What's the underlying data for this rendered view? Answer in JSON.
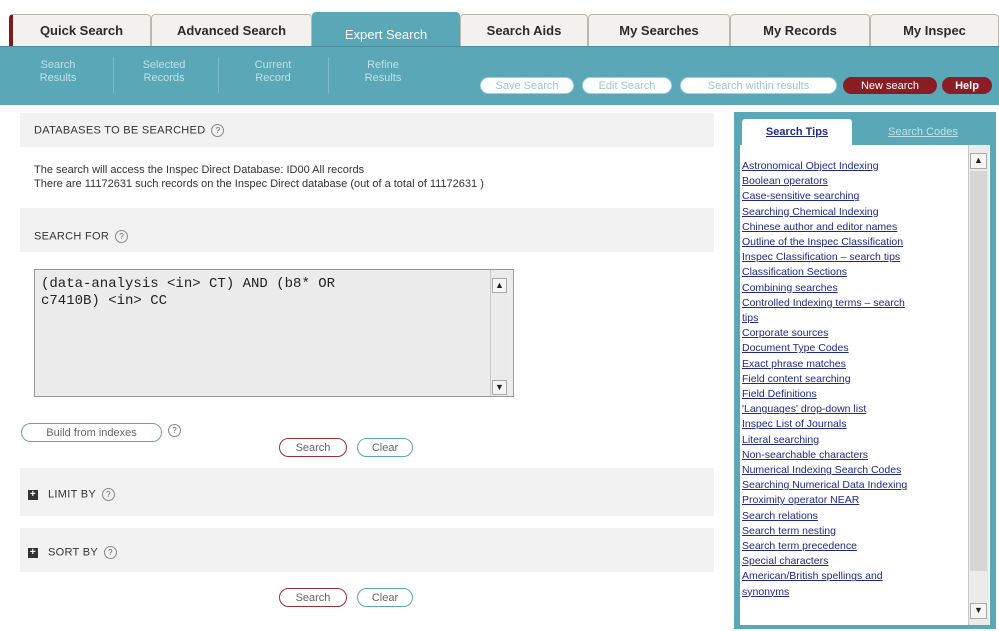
{
  "tabs": [
    {
      "label": "Quick Search"
    },
    {
      "label": "Advanced Search"
    },
    {
      "label": "Expert Search"
    },
    {
      "label": "Search Aids"
    },
    {
      "label": "My Searches"
    },
    {
      "label": "My Records"
    },
    {
      "label": "My Inspec"
    }
  ],
  "subnav": {
    "items": [
      {
        "line1": "Search",
        "line2": "Results"
      },
      {
        "line1": "Selected",
        "line2": "Records"
      },
      {
        "line1": "Current",
        "line2": "Record"
      },
      {
        "line1": "Refine",
        "line2": "Results"
      }
    ],
    "actions": {
      "save_search": "Save Search",
      "edit_search": "Edit Search",
      "search_within": "Search within results",
      "new_search": "New search",
      "help": "Help"
    }
  },
  "databases": {
    "heading": "DATABASES TO BE SEARCHED",
    "line1": "The search will access the Inspec Direct Database: ID00 All records",
    "line2": "There are 11172631 such records on the Inspec Direct database (out of a total of 11172631 )"
  },
  "search_for": {
    "heading": "SEARCH FOR",
    "query_value": "(data-analysis <in> CT) AND (b8* OR\nc7410B) <in> CC",
    "build_from_indexes": "Build from indexes",
    "search_button": "Search",
    "clear_button": "Clear"
  },
  "limit_by": {
    "heading": "LIMIT BY"
  },
  "sort_by": {
    "heading": "SORT BY"
  },
  "bottom": {
    "search_button": "Search",
    "clear_button": "Clear"
  },
  "help_icon_glyph": "?",
  "expand_icon_glyph": "+",
  "tips_panel": {
    "tab_active": "Search Tips",
    "tab_inactive": "Search Codes",
    "items": [
      "Astronomical Object Indexing",
      "Boolean operators",
      "Case-sensitive searching",
      "Searching Chemical Indexing",
      "Chinese author and editor names",
      "Outline of the Inspec Classification",
      "Inspec Classification – search tips",
      "Classification Sections",
      "Combining searches",
      "Controlled Indexing terms – search",
      "tips",
      "Corporate sources",
      "Document Type Codes",
      "Exact phrase matches",
      "Field content searching",
      "Field Definitions",
      "'Languages' drop-down list",
      "Inspec List of Journals",
      "Literal searching",
      "Non-searchable characters",
      "Numerical Indexing Search Codes",
      "Searching Numerical Data Indexing",
      "Proximity operator NEAR",
      "Search relations",
      "Search term nesting",
      "Search term precedence",
      "Special characters",
      "American/British spellings and",
      "synonyms"
    ]
  },
  "colors": {
    "teal": "#5aa7b8",
    "maroon": "#8a1c24",
    "link": "#1f2a8a"
  },
  "icons": {
    "help": "help-circle-icon",
    "expand": "plus-box-icon",
    "scroll_up": "scroll-up-arrow-icon",
    "scroll_down": "scroll-down-arrow-icon"
  }
}
